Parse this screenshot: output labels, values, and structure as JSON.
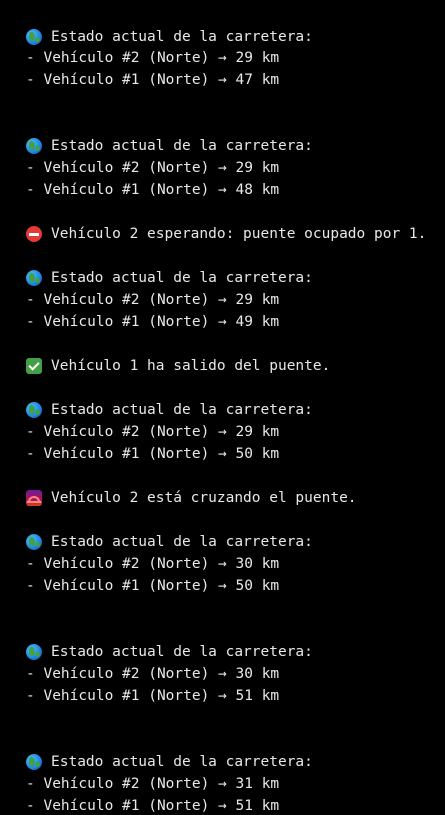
{
  "terminal": {
    "block1": {
      "icon": "globe-icon",
      "header": "Estado actual de la carretera:",
      "v2": "- Vehículo #2 (Norte) → 29 km",
      "v1": "- Vehículo #1 (Norte) → 47 km"
    },
    "block2": {
      "icon": "globe-icon",
      "header": "Estado actual de la carretera:",
      "v2": "- Vehículo #2 (Norte) → 29 km",
      "v1": "- Vehículo #1 (Norte) → 48 km"
    },
    "msg_waiting": {
      "icon": "no-entry-icon",
      "text": "Vehículo 2 esperando: puente ocupado por 1."
    },
    "block3": {
      "icon": "globe-icon",
      "header": "Estado actual de la carretera:",
      "v2": "- Vehículo #2 (Norte) → 29 km",
      "v1": "- Vehículo #1 (Norte) → 49 km"
    },
    "msg_exited": {
      "icon": "check-mark-icon",
      "text": "Vehículo 1 ha salido del puente."
    },
    "block4": {
      "icon": "globe-icon",
      "header": "Estado actual de la carretera:",
      "v2": "- Vehículo #2 (Norte) → 29 km",
      "v1": "- Vehículo #1 (Norte) → 50 km"
    },
    "msg_crossing": {
      "icon": "bridge-icon",
      "text": "Vehículo 2 está cruzando el puente."
    },
    "block5": {
      "icon": "globe-icon",
      "header": "Estado actual de la carretera:",
      "v2": "- Vehículo #2 (Norte) → 30 km",
      "v1": "- Vehículo #1 (Norte) → 50 km"
    },
    "block6": {
      "icon": "globe-icon",
      "header": "Estado actual de la carretera:",
      "v2": "- Vehículo #2 (Norte) → 30 km",
      "v1": "- Vehículo #1 (Norte) → 51 km"
    },
    "block7": {
      "icon": "globe-icon",
      "header": "Estado actual de la carretera:",
      "v2": "- Vehículo #2 (Norte) → 31 km",
      "v1": "- Vehículo #1 (Norte) → 51 km"
    }
  }
}
